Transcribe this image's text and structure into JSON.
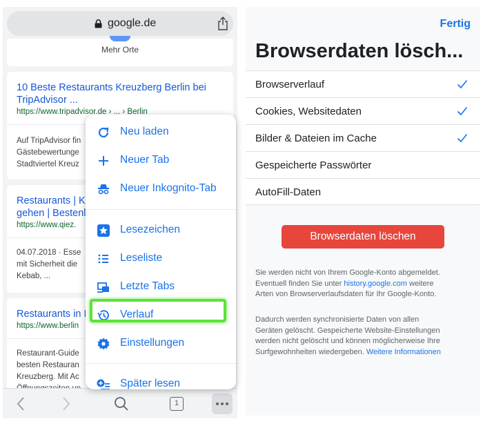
{
  "left": {
    "address_bar": {
      "url": "google.de",
      "lock_icon": "lock-icon",
      "share_icon": "share-icon"
    },
    "mehr_orte": "Mehr Orte",
    "results": [
      {
        "title_line1": "10 Beste Restaurants Kreuzberg Berlin bei",
        "title_line2": "TripAdvisor ...",
        "link": "https://www.tripadvisor.de › ... › Berlin",
        "snippet": [
          "Auf TripAdvisor fin",
          "Gästebewertunge",
          "Stadtviertel Kreuz"
        ]
      },
      {
        "title_line1": "Restaurants | K",
        "title_line2": "gehen | Bestenl",
        "link": "https://www.qiez.",
        "snippet": [
          "04.07.2018 · Esse",
          "mit Sicherheit die",
          "Kebab, ..."
        ]
      },
      {
        "title_line1": "Restaurants in I",
        "link": "https://www.berlin",
        "snippet": [
          "Restaurant-Guide",
          "besten Restauran",
          "Kreuzberg. Mit Ac",
          "Öffnungszeiten un"
        ]
      }
    ],
    "menu": {
      "items": [
        {
          "label": "Neu laden",
          "icon": "reload-icon"
        },
        {
          "label": "Neuer Tab",
          "icon": "plus-icon"
        },
        {
          "label": "Neuer Inkognito-Tab",
          "icon": "incognito-icon"
        },
        {
          "label": "Lesezeichen",
          "icon": "star-icon"
        },
        {
          "label": "Leseliste",
          "icon": "list-icon"
        },
        {
          "label": "Letzte Tabs",
          "icon": "recent-tabs-icon"
        },
        {
          "label": "Verlauf",
          "icon": "history-icon"
        },
        {
          "label": "Einstellungen",
          "icon": "gear-icon"
        },
        {
          "label": "Später lesen",
          "icon": "read-later-icon"
        }
      ]
    },
    "toolbar": {
      "tab_count": "1"
    }
  },
  "right": {
    "done": "Fertig",
    "title": "Browserdaten lösch...",
    "options": [
      {
        "label": "Browserverlauf",
        "checked": true
      },
      {
        "label": "Cookies, Websitedaten",
        "checked": true
      },
      {
        "label": "Bilder & Dateien im Cache",
        "checked": true
      },
      {
        "label": "Gespeicherte Passwörter",
        "checked": false
      },
      {
        "label": "AutoFill-Daten",
        "checked": false
      }
    ],
    "clear_button": "Browserdaten löschen",
    "info1": {
      "line1": "Sie werden nicht von Ihrem Google-Konto abgemeldet.",
      "line2_pre": "Eventuell finden Sie unter ",
      "line2_link": "history.google.com",
      "line2_post": " weitere",
      "line3": "Arten von Browserverlaufsdaten für Ihr Google-Konto."
    },
    "info2": {
      "line1": "Dadurch werden synchronisierte Daten von allen",
      "line2": "Geräten gelöscht. Gespeicherte Website-Einstellungen",
      "line3": "werden nicht gelöscht und können möglicherweise Ihre",
      "line4_pre": "Surfgewohnheiten wiedergeben. ",
      "line4_link": "Weitere Informationen"
    }
  },
  "colors": {
    "accent": "#1a73e8",
    "danger": "#e8453c",
    "highlight": "#5de23a",
    "link_green": "#0d652d"
  }
}
